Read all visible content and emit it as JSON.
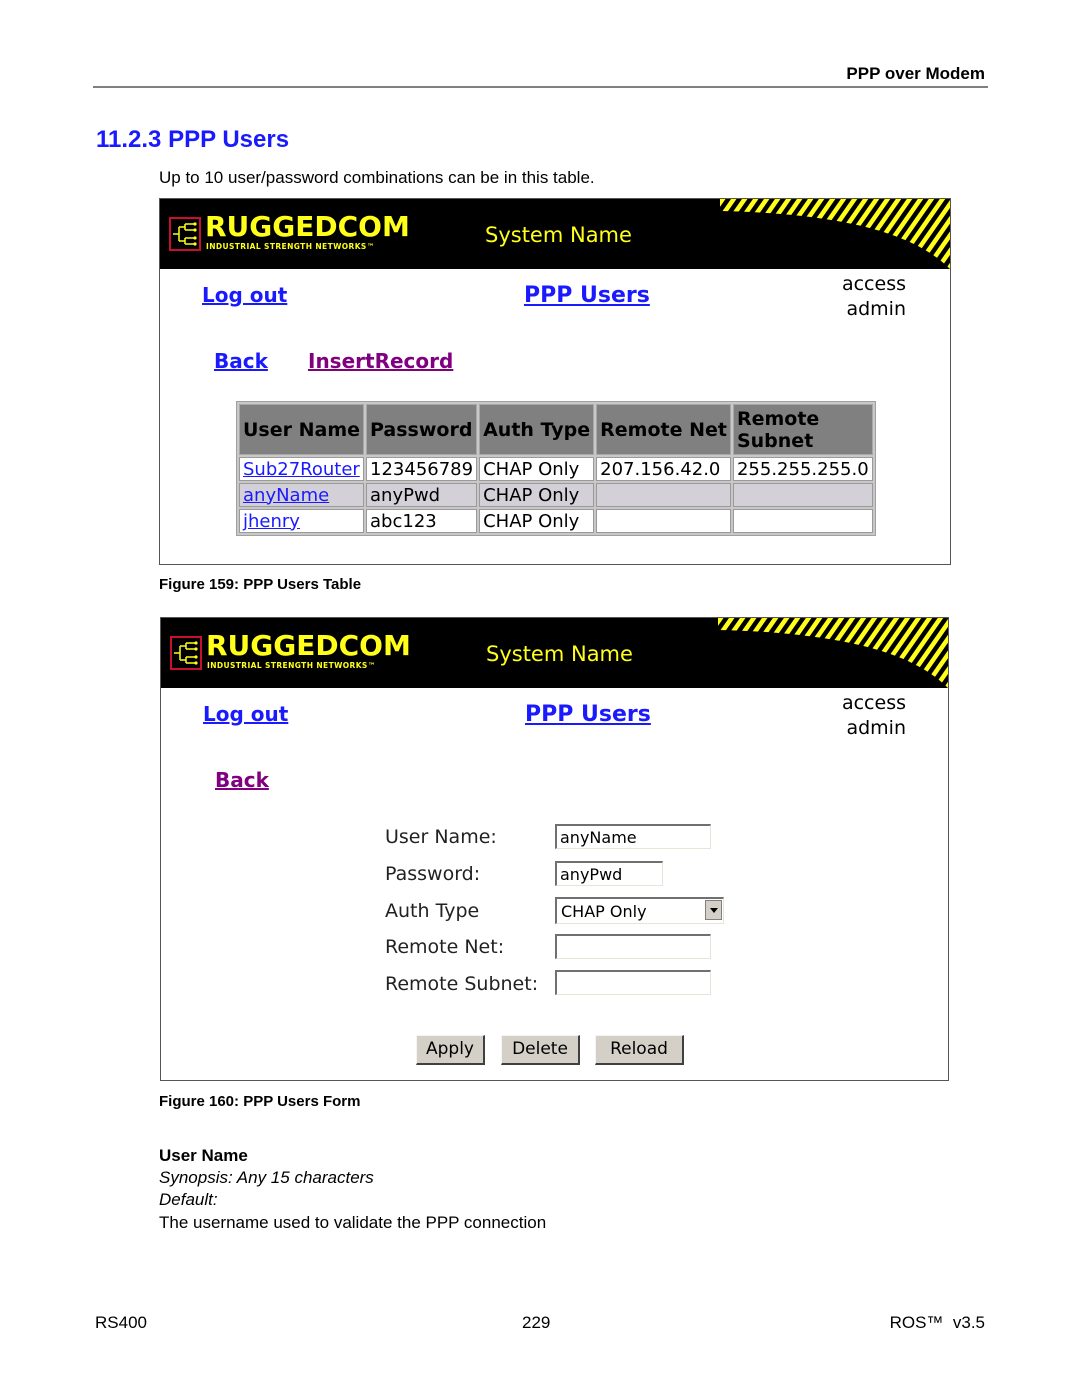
{
  "header": {
    "running_title": "PPP over Modem",
    "section_title": "11.2.3  PPP Users",
    "intro": "Up to 10 user/password combinations can be in this table."
  },
  "banner": {
    "brand": "RUGGEDCOM",
    "tagline": "INDUSTRIAL STRENGTH NETWORKS™",
    "system_name": "System Name",
    "colors": {
      "background": "#000000",
      "brand": "#ffff1a",
      "logo_border": "#c8102e"
    }
  },
  "figure1": {
    "logout": "Log out",
    "page_title": "PPP Users",
    "access_label": "access",
    "access_value": "admin",
    "back": "Back",
    "insert": "InsertRecord",
    "table": {
      "headers": [
        "User Name",
        "Password",
        "Auth Type",
        "Remote Net",
        "Remote Subnet"
      ],
      "rows": [
        [
          "Sub27Router",
          "123456789",
          "CHAP Only",
          "207.156.42.0",
          "255.255.255.0"
        ],
        [
          "anyName",
          "anyPwd",
          "CHAP Only",
          "",
          ""
        ],
        [
          "jhenry",
          "abc123",
          "CHAP Only",
          "",
          ""
        ]
      ]
    },
    "caption": "Figure 159: PPP Users Table"
  },
  "figure2": {
    "logout": "Log out",
    "page_title": "PPP Users",
    "access_label": "access",
    "access_value": "admin",
    "back": "Back",
    "form": {
      "user_name_label": "User Name:",
      "user_name_value": "anyName",
      "password_label": "Password:",
      "password_value": "anyPwd",
      "auth_type_label": "Auth Type",
      "auth_type_value": "CHAP Only",
      "remote_net_label": "Remote Net:",
      "remote_net_value": "",
      "remote_subnet_label": "Remote Subnet:",
      "remote_subnet_value": ""
    },
    "buttons": {
      "apply": "Apply",
      "delete": "Delete",
      "reload": "Reload"
    },
    "caption": "Figure 160: PPP Users Form"
  },
  "parameter": {
    "name": "User Name",
    "synopsis": "Synopsis: Any 15 characters",
    "default": "Default:",
    "description": "The username used to validate the PPP connection"
  },
  "footer": {
    "left": "RS400",
    "center": "229",
    "right": "ROS™  v3.5"
  }
}
